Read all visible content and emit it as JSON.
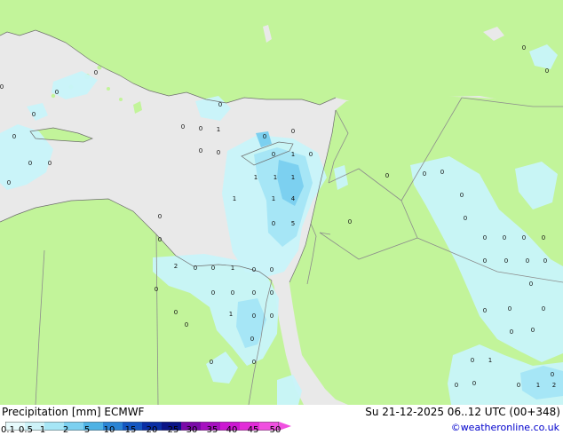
{
  "map": {
    "colors": {
      "sea": "#e9e9e9",
      "land": "#c2f49a",
      "border": "#8c8c8c",
      "precip_light": "#c8f4fa",
      "precip_medium": "#a6e6f6",
      "precip_heavy": "#7cd0f0"
    },
    "point_labels": [
      {
        "text": "0"
      },
      {
        "text": "0"
      },
      {
        "text": "0"
      },
      {
        "text": "0"
      },
      {
        "text": "0"
      },
      {
        "text": "0"
      },
      {
        "text": "0"
      },
      {
        "text": "0"
      },
      {
        "text": "0"
      },
      {
        "text": "0"
      },
      {
        "text": "1"
      },
      {
        "text": "0"
      },
      {
        "text": "0"
      },
      {
        "text": "0"
      },
      {
        "text": "0"
      },
      {
        "text": "0"
      },
      {
        "text": "0"
      },
      {
        "text": "1"
      },
      {
        "text": "0"
      },
      {
        "text": "1"
      },
      {
        "text": "1"
      },
      {
        "text": "1"
      },
      {
        "text": "1"
      },
      {
        "text": "1"
      },
      {
        "text": "4"
      },
      {
        "text": "0"
      },
      {
        "text": "5"
      },
      {
        "text": "0"
      },
      {
        "text": "0"
      },
      {
        "text": "2"
      },
      {
        "text": "0"
      },
      {
        "text": "0"
      },
      {
        "text": "1"
      },
      {
        "text": "0"
      },
      {
        "text": "0"
      },
      {
        "text": "0"
      },
      {
        "text": "0"
      },
      {
        "text": "0"
      },
      {
        "text": "0"
      },
      {
        "text": "0"
      },
      {
        "text": "0"
      },
      {
        "text": "1"
      },
      {
        "text": "0"
      },
      {
        "text": "0"
      },
      {
        "text": "0"
      },
      {
        "text": "0"
      },
      {
        "text": "0"
      },
      {
        "text": "0"
      },
      {
        "text": "0"
      },
      {
        "text": "0"
      },
      {
        "text": "0"
      },
      {
        "text": "0"
      },
      {
        "text": "0"
      },
      {
        "text": "0"
      },
      {
        "text": "0"
      },
      {
        "text": "0"
      },
      {
        "text": "0"
      },
      {
        "text": "0"
      },
      {
        "text": "0"
      },
      {
        "text": "0"
      },
      {
        "text": "0"
      },
      {
        "text": "0"
      },
      {
        "text": "0"
      },
      {
        "text": "0"
      },
      {
        "text": "0"
      },
      {
        "text": "0"
      },
      {
        "text": "0"
      },
      {
        "text": "0"
      },
      {
        "text": "1"
      },
      {
        "text": "0"
      },
      {
        "text": "0"
      },
      {
        "text": "0"
      },
      {
        "text": "0"
      },
      {
        "text": "1"
      },
      {
        "text": "2"
      },
      {
        "text": "0"
      },
      {
        "text": "0"
      },
      {
        "text": "0"
      }
    ]
  },
  "footer": {
    "title": "Precipitation [mm]  ECMWF",
    "datetime": "Su 21-12-2025 06..12 UTC (00+348)",
    "credit": "©weatheronline.co.uk"
  },
  "legend": {
    "labels": [
      "0.1",
      "0.5",
      "1",
      "2",
      "5",
      "10",
      "15",
      "20",
      "25",
      "30",
      "35",
      "40",
      "45",
      "50"
    ],
    "colors": [
      "#e6fafc",
      "#cdf2f8",
      "#a6e6f6",
      "#7cd0f0",
      "#4eb2e4",
      "#2a84d4",
      "#1456c0",
      "#0a2ea4",
      "#0a1486",
      "#7a0aa8",
      "#a610c0",
      "#cc18d2",
      "#e22cd8",
      "#f050e0"
    ]
  }
}
